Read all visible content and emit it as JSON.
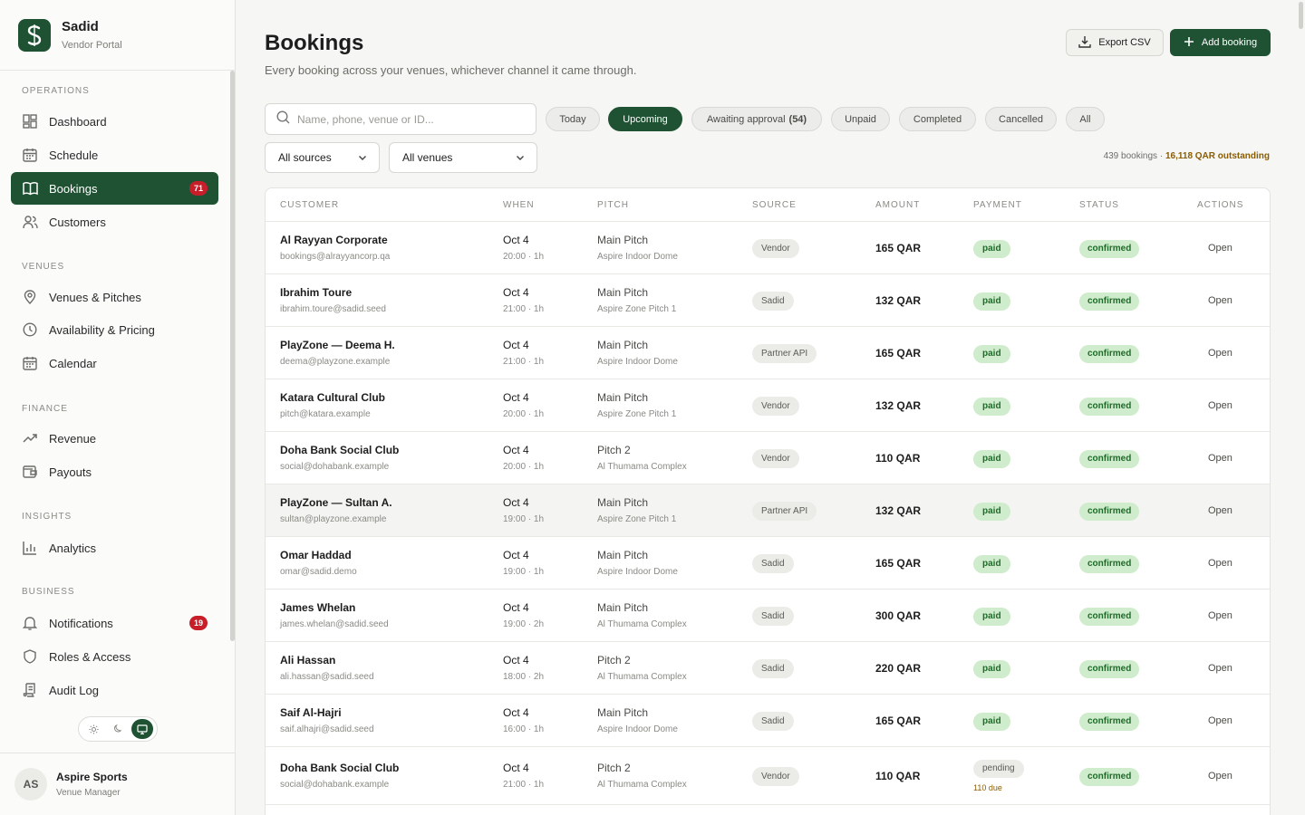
{
  "brand": {
    "name": "Sadid",
    "subtitle": "Vendor Portal"
  },
  "sidebar": {
    "sections": {
      "operations": "OPERATIONS",
      "venues": "VENUES",
      "finance": "FINANCE",
      "insights": "INSIGHTS",
      "business": "BUSINESS"
    },
    "items": {
      "dashboard": "Dashboard",
      "schedule": "Schedule",
      "bookings": "Bookings",
      "bookings_badge": "71",
      "customers": "Customers",
      "venues_pitches": "Venues & Pitches",
      "availability_pricing": "Availability & Pricing",
      "calendar": "Calendar",
      "revenue": "Revenue",
      "payouts": "Payouts",
      "analytics": "Analytics",
      "notifications": "Notifications",
      "notifications_badge": "19",
      "roles_access": "Roles & Access",
      "audit_log": "Audit Log"
    },
    "active_item": "bookings"
  },
  "theme": {
    "options": [
      "light",
      "dark",
      "system"
    ],
    "selected": "system"
  },
  "user": {
    "initials": "AS",
    "name": "Aspire Sports",
    "role": "Venue Manager"
  },
  "header": {
    "title": "Bookings",
    "subtitle": "Every booking across your venues, whichever channel it came through.",
    "export_label": "Export CSV",
    "add_label": "Add booking"
  },
  "search": {
    "placeholder": "Name, phone, venue or ID...",
    "value": ""
  },
  "filters": {
    "today": "Today",
    "upcoming": "Upcoming",
    "awaiting": "Awaiting approval",
    "awaiting_count": "(54)",
    "unpaid": "Unpaid",
    "completed": "Completed",
    "cancelled": "Cancelled",
    "all": "All",
    "selected": "upcoming",
    "sources": "All sources",
    "venues": "All venues"
  },
  "summary": {
    "count": "439 bookings",
    "separator": "·",
    "outstanding": "16,118 QAR outstanding"
  },
  "table": {
    "headers": {
      "customer": "CUSTOMER",
      "when": "WHEN",
      "pitch": "PITCH",
      "source": "SOURCE",
      "amount": "AMOUNT",
      "payment": "PAYMENT",
      "status": "STATUS",
      "actions": "ACTIONS"
    },
    "rows": [
      {
        "name": "Al Rayyan Corporate",
        "email": "bookings@alrayyancorp.qa",
        "date": "Oct 4",
        "time": "20:00 · 1h",
        "pitch": "Main Pitch",
        "venue": "Aspire Indoor Dome",
        "source": "Vendor",
        "amount": "165 QAR",
        "payment": "paid",
        "due": "",
        "status": "confirmed",
        "action": "Open"
      },
      {
        "name": "Ibrahim Toure",
        "email": "ibrahim.toure@sadid.seed",
        "date": "Oct 4",
        "time": "21:00 · 1h",
        "pitch": "Main Pitch",
        "venue": "Aspire Zone Pitch 1",
        "source": "Sadid",
        "amount": "132 QAR",
        "payment": "paid",
        "due": "",
        "status": "confirmed",
        "action": "Open"
      },
      {
        "name": "PlayZone — Deema H.",
        "email": "deema@playzone.example",
        "date": "Oct 4",
        "time": "21:00 · 1h",
        "pitch": "Main Pitch",
        "venue": "Aspire Indoor Dome",
        "source": "Partner API",
        "amount": "165 QAR",
        "payment": "paid",
        "due": "",
        "status": "confirmed",
        "action": "Open"
      },
      {
        "name": "Katara Cultural Club",
        "email": "pitch@katara.example",
        "date": "Oct 4",
        "time": "20:00 · 1h",
        "pitch": "Main Pitch",
        "venue": "Aspire Zone Pitch 1",
        "source": "Vendor",
        "amount": "132 QAR",
        "payment": "paid",
        "due": "",
        "status": "confirmed",
        "action": "Open"
      },
      {
        "name": "Doha Bank Social Club",
        "email": "social@dohabank.example",
        "date": "Oct 4",
        "time": "20:00 · 1h",
        "pitch": "Pitch 2",
        "venue": "Al Thumama Complex",
        "source": "Vendor",
        "amount": "110 QAR",
        "payment": "paid",
        "due": "",
        "status": "confirmed",
        "action": "Open"
      },
      {
        "name": "PlayZone — Sultan A.",
        "email": "sultan@playzone.example",
        "date": "Oct 4",
        "time": "19:00 · 1h",
        "pitch": "Main Pitch",
        "venue": "Aspire Zone Pitch 1",
        "source": "Partner API",
        "amount": "132 QAR",
        "payment": "paid",
        "due": "",
        "status": "confirmed",
        "action": "Open"
      },
      {
        "name": "Omar Haddad",
        "email": "omar@sadid.demo",
        "date": "Oct 4",
        "time": "19:00 · 1h",
        "pitch": "Main Pitch",
        "venue": "Aspire Indoor Dome",
        "source": "Sadid",
        "amount": "165 QAR",
        "payment": "paid",
        "due": "",
        "status": "confirmed",
        "action": "Open"
      },
      {
        "name": "James Whelan",
        "email": "james.whelan@sadid.seed",
        "date": "Oct 4",
        "time": "19:00 · 2h",
        "pitch": "Main Pitch",
        "venue": "Al Thumama Complex",
        "source": "Sadid",
        "amount": "300 QAR",
        "payment": "paid",
        "due": "",
        "status": "confirmed",
        "action": "Open"
      },
      {
        "name": "Ali Hassan",
        "email": "ali.hassan@sadid.seed",
        "date": "Oct 4",
        "time": "18:00 · 2h",
        "pitch": "Pitch 2",
        "venue": "Al Thumama Complex",
        "source": "Sadid",
        "amount": "220 QAR",
        "payment": "paid",
        "due": "",
        "status": "confirmed",
        "action": "Open"
      },
      {
        "name": "Saif Al-Hajri",
        "email": "saif.alhajri@sadid.seed",
        "date": "Oct 4",
        "time": "16:00 · 1h",
        "pitch": "Main Pitch",
        "venue": "Aspire Indoor Dome",
        "source": "Sadid",
        "amount": "165 QAR",
        "payment": "paid",
        "due": "",
        "status": "confirmed",
        "action": "Open"
      },
      {
        "name": "Doha Bank Social Club",
        "email": "social@dohabank.example",
        "date": "Oct 4",
        "time": "21:00 · 1h",
        "pitch": "Pitch 2",
        "venue": "Al Thumama Complex",
        "source": "Vendor",
        "amount": "110 QAR",
        "payment": "pending",
        "due": "110 due",
        "status": "confirmed",
        "action": "Open"
      }
    ]
  },
  "colors": {
    "brand_green": "#1f5233",
    "badge_red": "#c81e2a",
    "paid_bg": "#cfeccc",
    "paid_text": "#1f6b2a",
    "due_text": "#8a5c00"
  }
}
